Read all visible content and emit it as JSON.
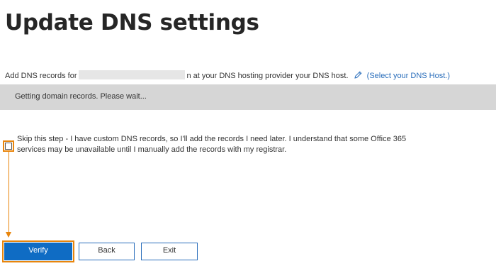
{
  "page": {
    "title": "Update DNS settings"
  },
  "intro": {
    "prefix": "Add DNS records for",
    "suffix": "n at your DNS hosting provider your DNS host.",
    "edit_icon": "pencil-icon",
    "link_text": "(Select your DNS Host.)"
  },
  "status": {
    "message": "Getting domain records. Please wait..."
  },
  "skip_option": {
    "checked": false,
    "text": "Skip this step - I have custom DNS records, so I'll add the records I need later. I understand that some Office 365 services may be unavailable until I manually add the records with my registrar."
  },
  "buttons": {
    "verify": "Verify",
    "back": "Back",
    "exit": "Exit"
  },
  "colors": {
    "highlight": "#e8850c",
    "primary": "#0f6cc4",
    "link": "#2a6ebb",
    "status_bar": "#d6d6d6"
  }
}
